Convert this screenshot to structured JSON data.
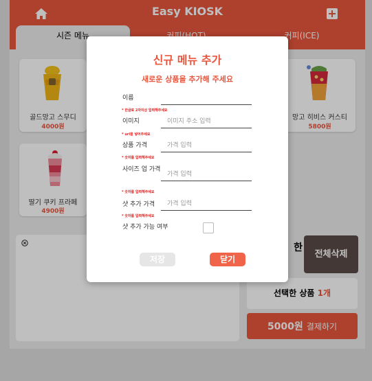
{
  "header": {
    "title": "Easy KIOSK"
  },
  "tabs": [
    {
      "label": "시즌 메뉴"
    },
    {
      "label": "커피(HOT)"
    },
    {
      "label": "커피(ICE)"
    }
  ],
  "menu_items": [
    {
      "name": "골드망고 스무디",
      "price": "4000원"
    },
    {
      "name": "딸기 쿠키 프라페",
      "price": "4900원"
    },
    {
      "name": "망고 히비스 커스티",
      "price": "5800원"
    }
  ],
  "cart": {
    "title_partial": "한",
    "delete_all": "전체삭제",
    "selected_label": "선택한 상품",
    "selected_count": "1개",
    "pay_amount": "5000원",
    "pay_label": "결제하기"
  },
  "modal": {
    "title": "신규 메뉴 추가",
    "subtitle": "새로운 상품을 추가해 주세요",
    "fields": [
      {
        "label": "이름",
        "placeholder": "",
        "hint": "* 한글로 2자이상 입력해주세요"
      },
      {
        "label": "이미지",
        "placeholder": "이미지 주소 입력",
        "hint": "* url을 넣어주세요"
      },
      {
        "label": "상품 가격",
        "placeholder": "가격 입력",
        "hint": "* 숫자를 입력해주세요"
      },
      {
        "label": "사이즈 업 가격",
        "placeholder": "가격 입력",
        "hint": "* 숫자를 입력해주세요"
      },
      {
        "label": "샷 추가 가격",
        "placeholder": "가격 입력",
        "hint": "* 숫자를 입력해주세요"
      }
    ],
    "shot_option_label": "샷 추가 가능 여부",
    "save_label": "저장",
    "close_label": "닫기"
  },
  "colors": {
    "accent": "#e8563e",
    "hint_red": "#e02020",
    "delete_btn": "#5a4b48"
  }
}
